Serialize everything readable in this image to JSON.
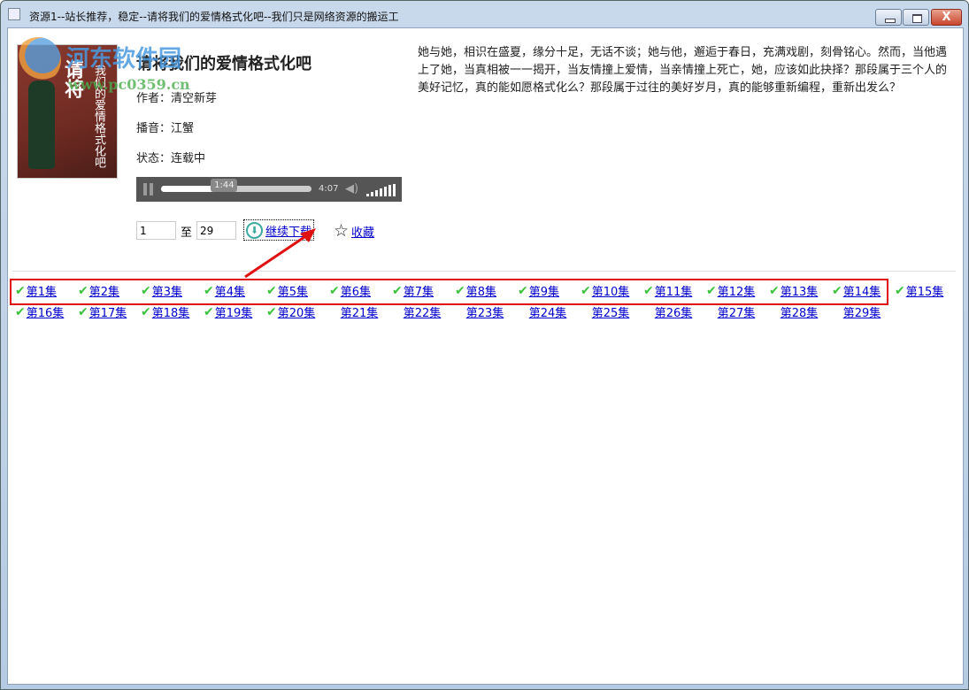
{
  "window": {
    "title": "资源1--站长推荐，稳定--请将我们的爱情格式化吧--我们只是网络资源的搬运工",
    "close_label": "X"
  },
  "watermark": {
    "name": "河东软件园",
    "url": "www.pc0359.cn"
  },
  "book": {
    "cover_text_large": "请将",
    "cover_text_small": "我们的爱情格式化吧",
    "title": "请将我们的爱情格式化吧",
    "author": "作者：清空新芽",
    "narrator": "播音：江蟹",
    "status": "状态：连载中",
    "description": "她与她，相识在盛夏，缘分十足，无话不谈；她与他，邂逅于春日，充满戏剧，刻骨铭心。然而，当他遇上了她，当真相被一一揭开，当友情撞上爱情，当亲情撞上死亡，她，应该如此抉择？那段属于三个人的美好记忆，真的能如愿格式化么？那段属于过往的美好岁月，真的能够重新编程，重新出发么？"
  },
  "player": {
    "current_time": "1:44",
    "duration": "4:07",
    "progress": 0.42,
    "volume": 1.0,
    "state": "playing"
  },
  "download": {
    "from": "1",
    "to_label": "至",
    "to": "29",
    "continue_label": "继续下载",
    "favorite_label": "收藏"
  },
  "colors": {
    "highlight": "#e01010",
    "check": "#3cc23c",
    "link": "#0000cc"
  },
  "episodes": [
    {
      "label": "第1集",
      "downloaded": true
    },
    {
      "label": "第2集",
      "downloaded": true
    },
    {
      "label": "第3集",
      "downloaded": true
    },
    {
      "label": "第4集",
      "downloaded": true
    },
    {
      "label": "第5集",
      "downloaded": true
    },
    {
      "label": "第6集",
      "downloaded": true
    },
    {
      "label": "第7集",
      "downloaded": true
    },
    {
      "label": "第8集",
      "downloaded": true
    },
    {
      "label": "第9集",
      "downloaded": true
    },
    {
      "label": "第10集",
      "downloaded": true
    },
    {
      "label": "第11集",
      "downloaded": true
    },
    {
      "label": "第12集",
      "downloaded": true
    },
    {
      "label": "第13集",
      "downloaded": true
    },
    {
      "label": "第14集",
      "downloaded": true
    },
    {
      "label": "第15集",
      "downloaded": true
    },
    {
      "label": "第16集",
      "downloaded": true
    },
    {
      "label": "第17集",
      "downloaded": true
    },
    {
      "label": "第18集",
      "downloaded": true
    },
    {
      "label": "第19集",
      "downloaded": true
    },
    {
      "label": "第20集",
      "downloaded": true
    },
    {
      "label": "第21集",
      "downloaded": false
    },
    {
      "label": "第22集",
      "downloaded": false
    },
    {
      "label": "第23集",
      "downloaded": false
    },
    {
      "label": "第24集",
      "downloaded": false
    },
    {
      "label": "第25集",
      "downloaded": false
    },
    {
      "label": "第26集",
      "downloaded": false
    },
    {
      "label": "第27集",
      "downloaded": false
    },
    {
      "label": "第28集",
      "downloaded": false
    },
    {
      "label": "第29集",
      "downloaded": false
    }
  ]
}
